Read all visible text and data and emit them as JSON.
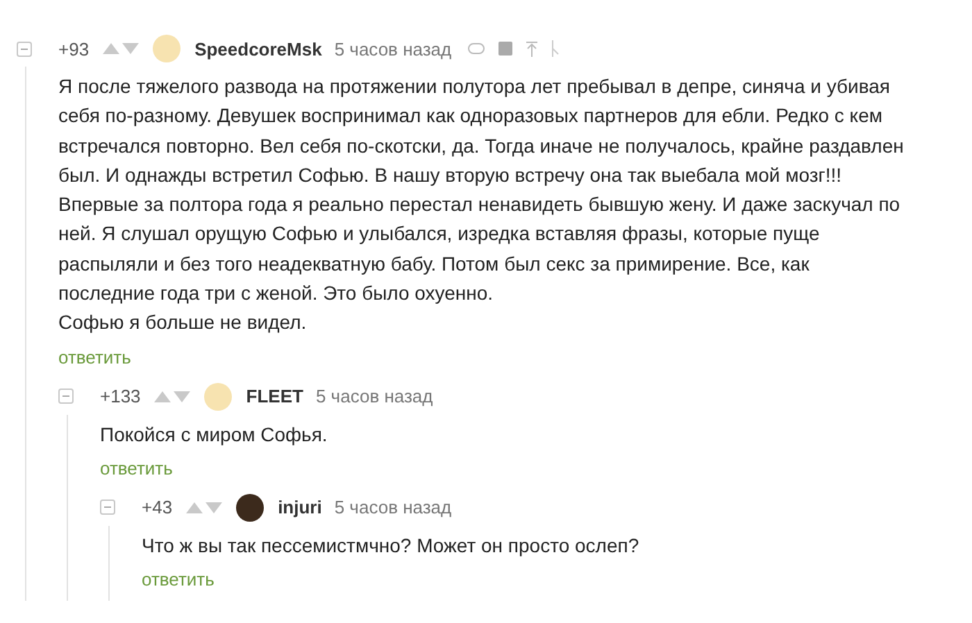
{
  "comments": [
    {
      "score": "+93",
      "author": "SpeedcoreMsk",
      "avatar": {
        "kind": "default"
      },
      "time": "5 часов назад",
      "actions": true,
      "text": "Я после тяжелого развода на протяжении полутора лет пребывал в депре, синяча и убивая\nсебя по-разному. Девушек воспринимал как одноразовых партнеров для ебли. Редко с кем\nвстречался повторно. Вел себя по-скотски, да. Тогда иначе не получалось, крайне раздавлен\nбыл. И однажды встретил Софью. В нашу вторую встречу она так выебала мой мозг!!!\nВпервые за полтора года я реально перестал ненавидеть бывшую жену. И даже заскучал по\nней. Я слушал орущую Софью и улыбался, изредка вставляя фразы, которые пуще\nраспыляли и без того неадекватную бабу. Потом был секс за примирение. Все, как\nпоследние года три с женой. Это было охуенно.\nСофью я больше не видел.",
      "reply": "ответить",
      "children": [
        {
          "score": "+133",
          "author": "FLEET",
          "avatar": {
            "kind": "default"
          },
          "time": "5 часов назад",
          "actions": false,
          "text": "Покойся с миром Софья.",
          "reply": "ответить",
          "children": [
            {
              "score": "+43",
              "author": "injuri",
              "avatar": {
                "kind": "photo"
              },
              "time": "5 часов назад",
              "actions": false,
              "text": "Что ж вы так пессемистмчно? Может он просто ослеп?",
              "reply": "ответить"
            }
          ]
        }
      ]
    }
  ]
}
